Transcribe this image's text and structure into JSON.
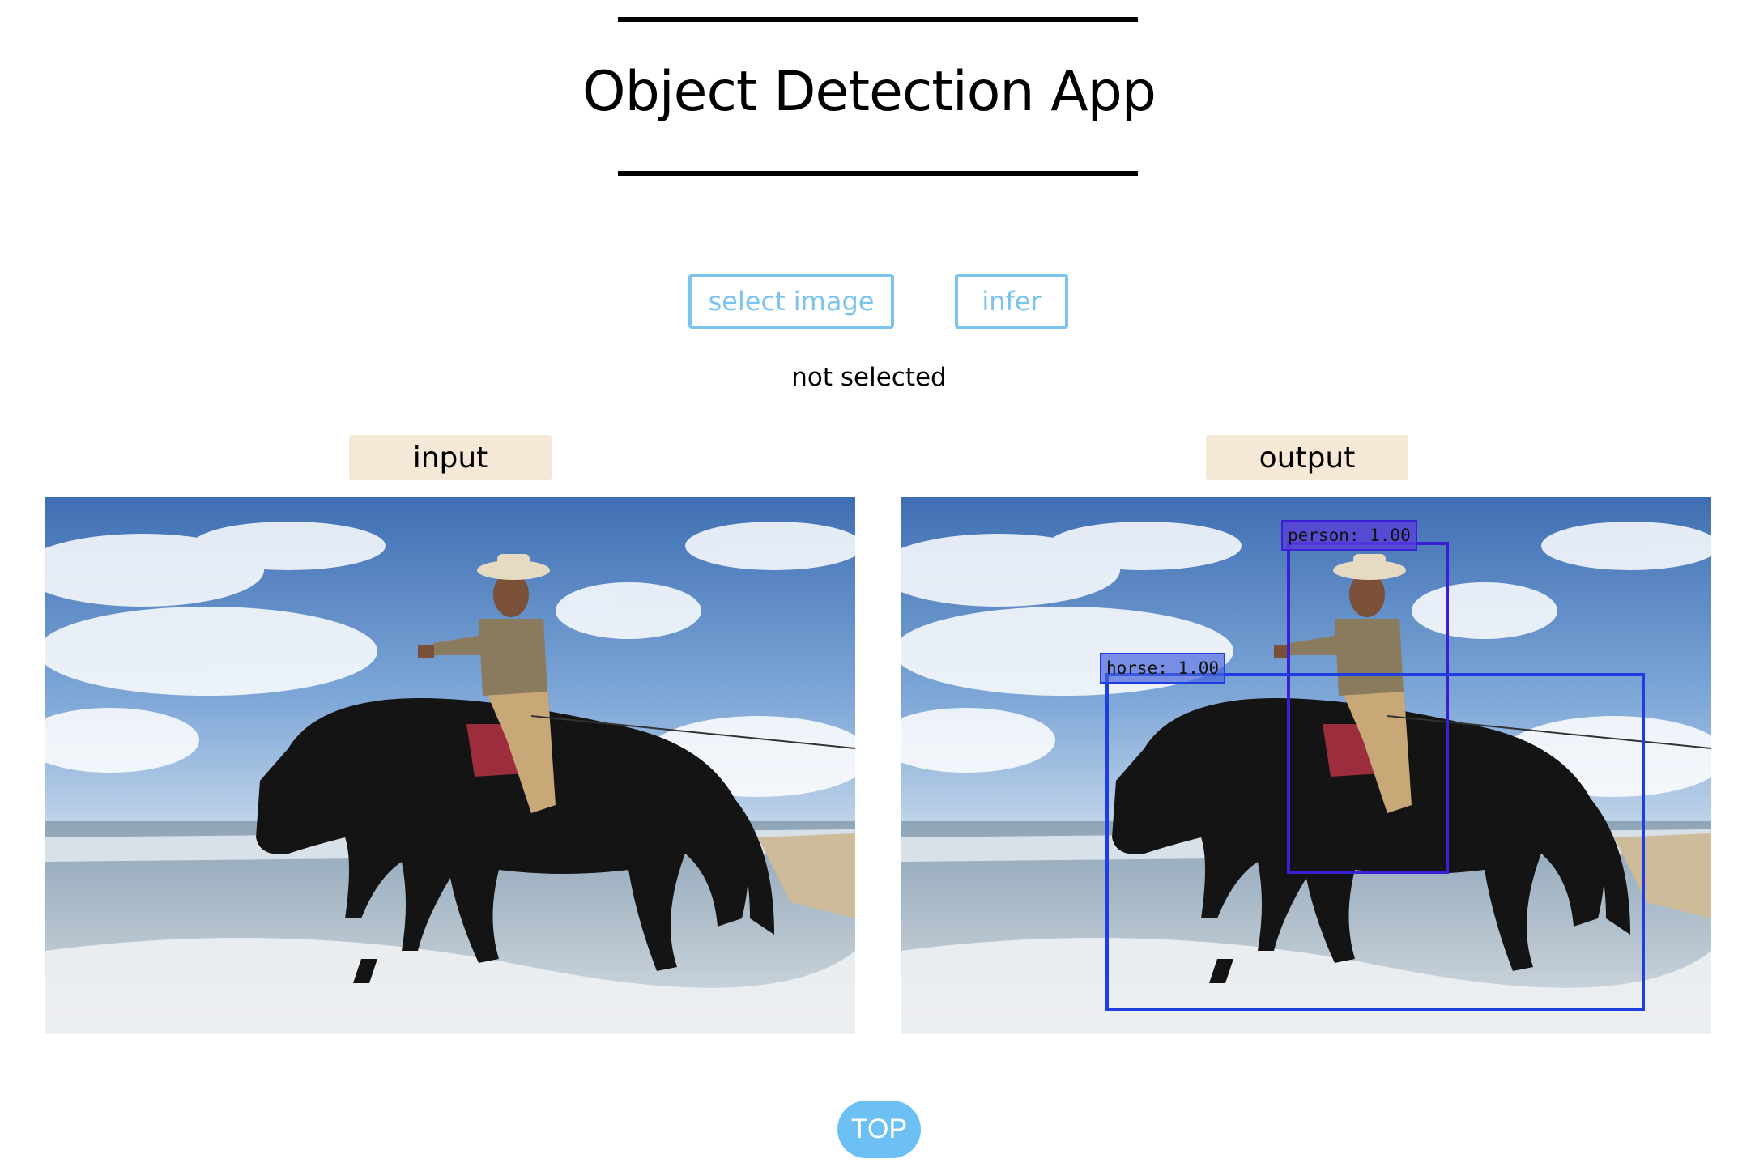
{
  "app": {
    "title": "Object Detection App"
  },
  "controls": {
    "select_label": "select image",
    "infer_label": "infer",
    "status": "not selected"
  },
  "panels": {
    "input_label": "input",
    "output_label": "output"
  },
  "detections": [
    {
      "label": "person: 1.00",
      "class": "person",
      "score": 1.0,
      "color": "#3a1fd6"
    },
    {
      "label": "horse: 1.00",
      "class": "horse",
      "score": 1.0,
      "color": "#1f3ee0"
    }
  ],
  "footer": {
    "top_label": "TOP"
  },
  "colors": {
    "accent": "#7cc4ee",
    "label_bg": "#f5e8d6",
    "top_button": "#6cc0f3"
  }
}
